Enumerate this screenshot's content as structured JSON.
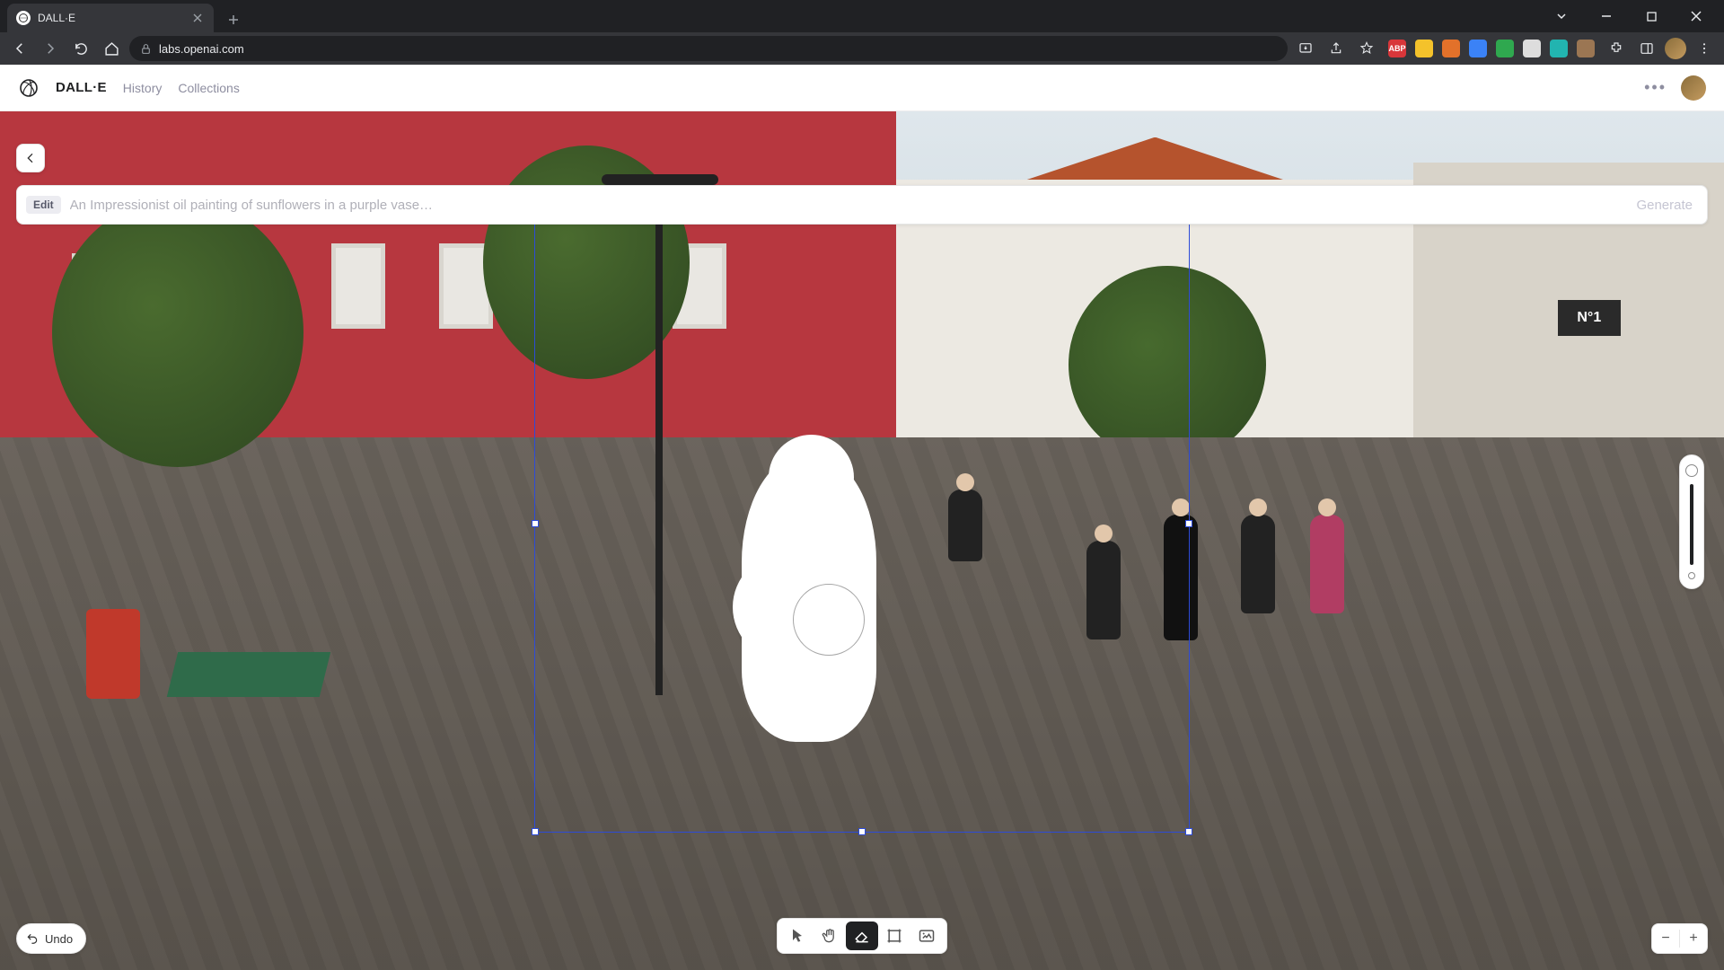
{
  "browser": {
    "tab_title": "DALL·E",
    "url_scheme_icon": "lock",
    "url": "labs.openai.com",
    "extensions": [
      {
        "name": "abp",
        "bg": "#d8363a",
        "label": "ABP"
      },
      {
        "name": "ext-yellow",
        "bg": "#f4c22b",
        "label": ""
      },
      {
        "name": "ext-orange",
        "bg": "#e2712a",
        "label": ""
      },
      {
        "name": "ext-blue",
        "bg": "#3b82f6",
        "label": ""
      },
      {
        "name": "ext-green",
        "bg": "#2fa84f",
        "label": ""
      },
      {
        "name": "ext-white",
        "bg": "#ddd",
        "label": ""
      },
      {
        "name": "ext-teal",
        "bg": "#22b4b0",
        "label": ""
      },
      {
        "name": "ext-brown",
        "bg": "#9b7653",
        "label": ""
      }
    ]
  },
  "header": {
    "brand": "DALL·E",
    "nav": [
      "History",
      "Collections"
    ]
  },
  "prompt": {
    "badge": "Edit",
    "placeholder": "An Impressionist oil painting of sunflowers in a purple vase…",
    "value": "",
    "generate": "Generate"
  },
  "undo_label": "Undo",
  "scene_sign": "N°1",
  "tools": [
    {
      "id": "cursor",
      "icon": "cursor",
      "active": false
    },
    {
      "id": "pan",
      "icon": "hand",
      "active": false
    },
    {
      "id": "eraser",
      "icon": "eraser",
      "active": true
    },
    {
      "id": "frame",
      "icon": "frame",
      "active": false
    },
    {
      "id": "upload",
      "icon": "upload-image",
      "active": false
    }
  ]
}
